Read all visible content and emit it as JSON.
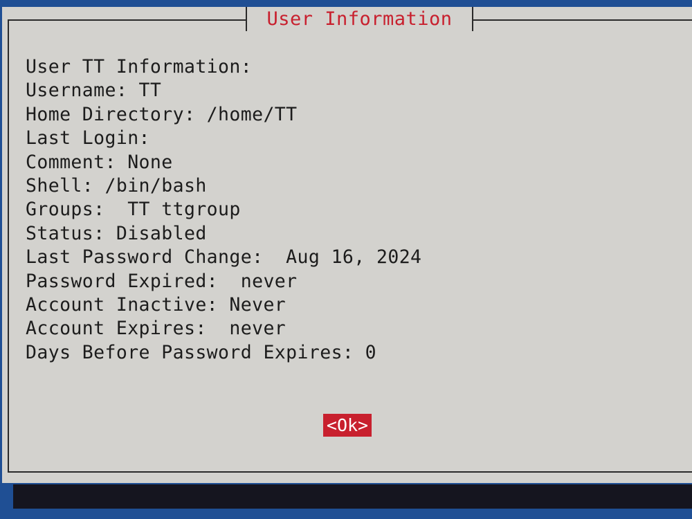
{
  "dialog": {
    "title": "User Information",
    "lines": [
      "User TT Information:",
      "Username: TT",
      "Home Directory: /home/TT",
      "Last Login:",
      "Comment: None",
      "Shell: /bin/bash",
      "Groups:  TT ttgroup",
      "Status: Disabled",
      "Last Password Change:  Aug 16, 2024",
      "Password Expired:  never",
      "Account Inactive: Never",
      "Account Expires:  never",
      "Days Before Password Expires: 0"
    ],
    "ok_label": "<Ok>"
  },
  "colors": {
    "screen_background": "#1f4f94",
    "dialog_background": "#d3d2ce",
    "accent": "#c8202e",
    "text": "#1c1c1c",
    "shadow": "#15151f"
  }
}
